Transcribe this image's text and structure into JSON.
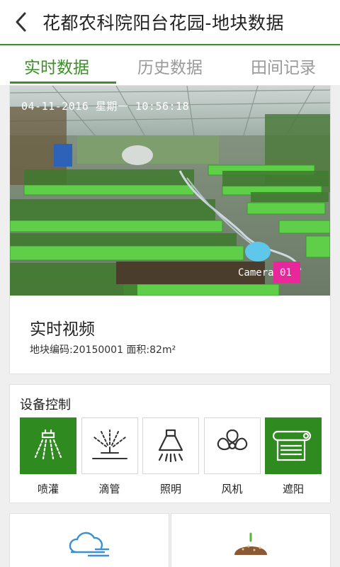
{
  "header": {
    "title": "花都农科院阳台花园-地块数据",
    "back_icon": "chevron-left-icon"
  },
  "tabs": [
    {
      "label": "实时数据",
      "active": true
    },
    {
      "label": "历史数据",
      "active": false
    },
    {
      "label": "田间记录",
      "active": false
    }
  ],
  "video": {
    "osd_timestamp": "04-11-2016 星期一 10:56:18",
    "osd_camera": "Camera 01",
    "title": "实时视频",
    "info": "地块编码:20150001  面积:82m²"
  },
  "devices": {
    "title": "设备控制",
    "items": [
      {
        "label": "喷灌",
        "icon": "sprinkler-icon",
        "on": true
      },
      {
        "label": "滴管",
        "icon": "drip-irrigation-icon",
        "on": false
      },
      {
        "label": "照明",
        "icon": "lamp-icon",
        "on": false
      },
      {
        "label": "风机",
        "icon": "fan-icon",
        "on": false
      },
      {
        "label": "遮阳",
        "icon": "sunshade-icon",
        "on": true
      }
    ]
  },
  "bottom_cards": [
    {
      "icon": "cloud-fog-icon"
    },
    {
      "icon": "soil-sprout-icon"
    }
  ],
  "colors": {
    "accent": "#3e8e2a",
    "device_on": "#2f8b1f",
    "tab_inactive": "#9a9a9a"
  }
}
